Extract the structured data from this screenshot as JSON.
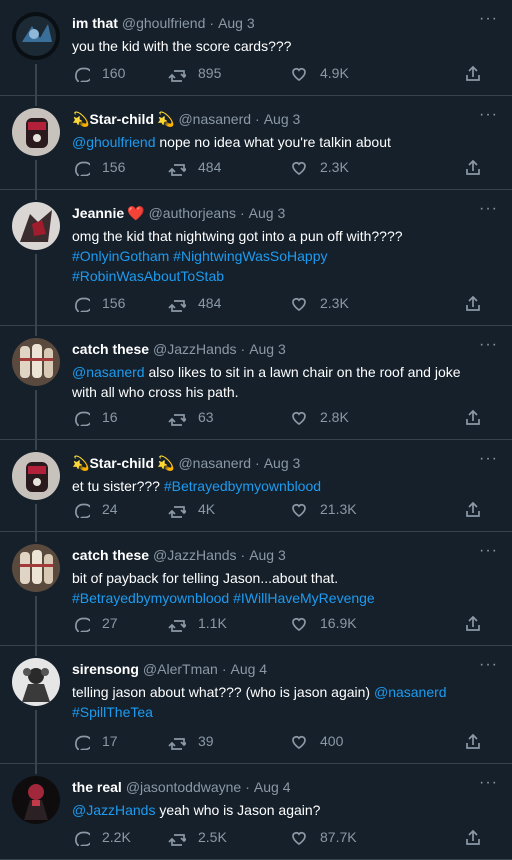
{
  "tweets": [
    {
      "name": "im that",
      "handle": "@ghoulfriend",
      "time": "Aug 3",
      "segments": [
        {
          "t": "you the kid with the score cards???",
          "link": false
        }
      ],
      "replies": "160",
      "retweets": "895",
      "likes": "4.9K",
      "avatar": "avatar-dark-blue-art"
    },
    {
      "name": "Star-child",
      "name_prefix": "💫",
      "name_suffix": "💫",
      "handle": "@nasanerd",
      "time": "Aug 3",
      "segments": [
        {
          "t": "@ghoulfriend",
          "link": true
        },
        {
          "t": " nope no idea what you're talkin about",
          "link": false
        }
      ],
      "replies": "156",
      "retweets": "484",
      "likes": "2.3K",
      "avatar": "avatar-red-cap"
    },
    {
      "name": "Jeannie",
      "name_suffix": "❤️",
      "handle": "@authorjeans",
      "time": "Aug 3",
      "segments": [
        {
          "t": "omg the kid that nightwing got into a pun off with???? ",
          "link": false
        },
        {
          "t": "#OnlyinGotham",
          "link": true
        },
        {
          "t": " ",
          "link": false
        },
        {
          "t": "#NightwingWasSoHappy",
          "link": true
        },
        {
          "t": " ",
          "link": false
        },
        {
          "t": "#RobinWasAboutToStab",
          "link": true
        }
      ],
      "replies": "156",
      "retweets": "484",
      "likes": "2.3K",
      "avatar": "avatar-red-figure"
    },
    {
      "name": "catch these",
      "handle": "@JazzHands",
      "time": "Aug 3",
      "segments": [
        {
          "t": "@nasanerd",
          "link": true
        },
        {
          "t": " also likes to sit in a lawn chair on the roof and joke with all who cross his path.",
          "link": false
        }
      ],
      "replies": "16",
      "retweets": "63",
      "likes": "2.8K",
      "avatar": "avatar-taped-hands"
    },
    {
      "name": "Star-child",
      "name_prefix": "💫",
      "name_suffix": "💫",
      "handle": "@nasanerd",
      "time": "Aug 3",
      "segments": [
        {
          "t": "et tu sister??? ",
          "link": false
        },
        {
          "t": "#Betrayedbymyownblood",
          "link": true
        }
      ],
      "replies": "24",
      "retweets": "4K",
      "likes": "21.3K",
      "avatar": "avatar-red-cap"
    },
    {
      "name": "catch these",
      "handle": "@JazzHands",
      "time": "Aug 3",
      "segments": [
        {
          "t": "bit of payback for telling Jason...about that. ",
          "link": false
        },
        {
          "t": "#Betrayedbymyownblood",
          "link": true
        },
        {
          "t": " ",
          "link": false
        },
        {
          "t": "#IWillHaveMyRevenge",
          "link": true
        }
      ],
      "replies": "27",
      "retweets": "1.1K",
      "likes": "16.9K",
      "avatar": "avatar-taped-hands"
    },
    {
      "name": "sirensong",
      "handle": "@AlerTman",
      "time": "Aug 4",
      "segments": [
        {
          "t": "telling jason about what??? (who is jason again) ",
          "link": false
        },
        {
          "t": "@nasanerd",
          "link": true
        },
        {
          "t": " ",
          "link": false
        },
        {
          "t": "#SpillTheTea",
          "link": true
        }
      ],
      "replies": "17",
      "retweets": "39",
      "likes": "400",
      "avatar": "avatar-grey-figure"
    },
    {
      "name": "the real",
      "handle": "@jasontoddwayne",
      "time": "Aug 4",
      "segments": [
        {
          "t": "@JazzHands",
          "link": true
        },
        {
          "t": " yeah who is Jason again?",
          "link": false
        }
      ],
      "replies": "2.2K",
      "retweets": "2.5K",
      "likes": "87.7K",
      "avatar": "avatar-red-hood"
    }
  ],
  "icons": {
    "reply": "reply-icon",
    "retweet": "retweet-icon",
    "like": "heart-icon",
    "share": "share-icon",
    "more": "more-icon"
  },
  "colors": {
    "background": "#15202b",
    "link": "#1d9bf0",
    "muted": "#8b98a5",
    "divider": "#38444d"
  }
}
